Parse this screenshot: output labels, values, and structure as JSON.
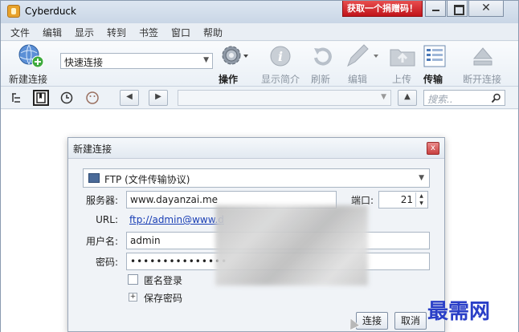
{
  "window": {
    "title": "Cyberduck",
    "donate_button": "获取一个捐赠码！",
    "close_glyph": "✕"
  },
  "menu": {
    "items": [
      "文件",
      "编辑",
      "显示",
      "转到",
      "书签",
      "窗口",
      "帮助"
    ]
  },
  "toolbar": {
    "new_connection": "新建连接",
    "quick_connect_value": "快速连接",
    "action": "操作",
    "info": "显示简介",
    "refresh": "刷新",
    "edit": "编辑",
    "upload": "上传",
    "transfers": "传输",
    "disconnect": "断开连接"
  },
  "subbar": {
    "search_placeholder": "搜索..",
    "back_glyph": "◀",
    "forward_glyph": "▶",
    "up_glyph": "▲"
  },
  "dialog": {
    "title": "新建连接",
    "close_glyph": "x",
    "protocol": "FTP (文件传输协议)",
    "server_label": "服务器:",
    "server_value": "www.dayanzai.me",
    "port_label": "端口:",
    "port_value": "21",
    "url_label": "URL:",
    "url_value": "ftp://admin@www.d",
    "username_label": "用户名:",
    "username_value": "admin",
    "password_label": "密码:",
    "password_value": "•••••••••••••••",
    "anonymous_label": "匿名登录",
    "save_password_label": "保存密码",
    "connect_button": "连接",
    "cancel_button": "取消"
  },
  "watermark": "最需网",
  "colors": {
    "donate": "#c1141b",
    "link": "#1a3fb5",
    "watermark": "#2a3fc7"
  }
}
